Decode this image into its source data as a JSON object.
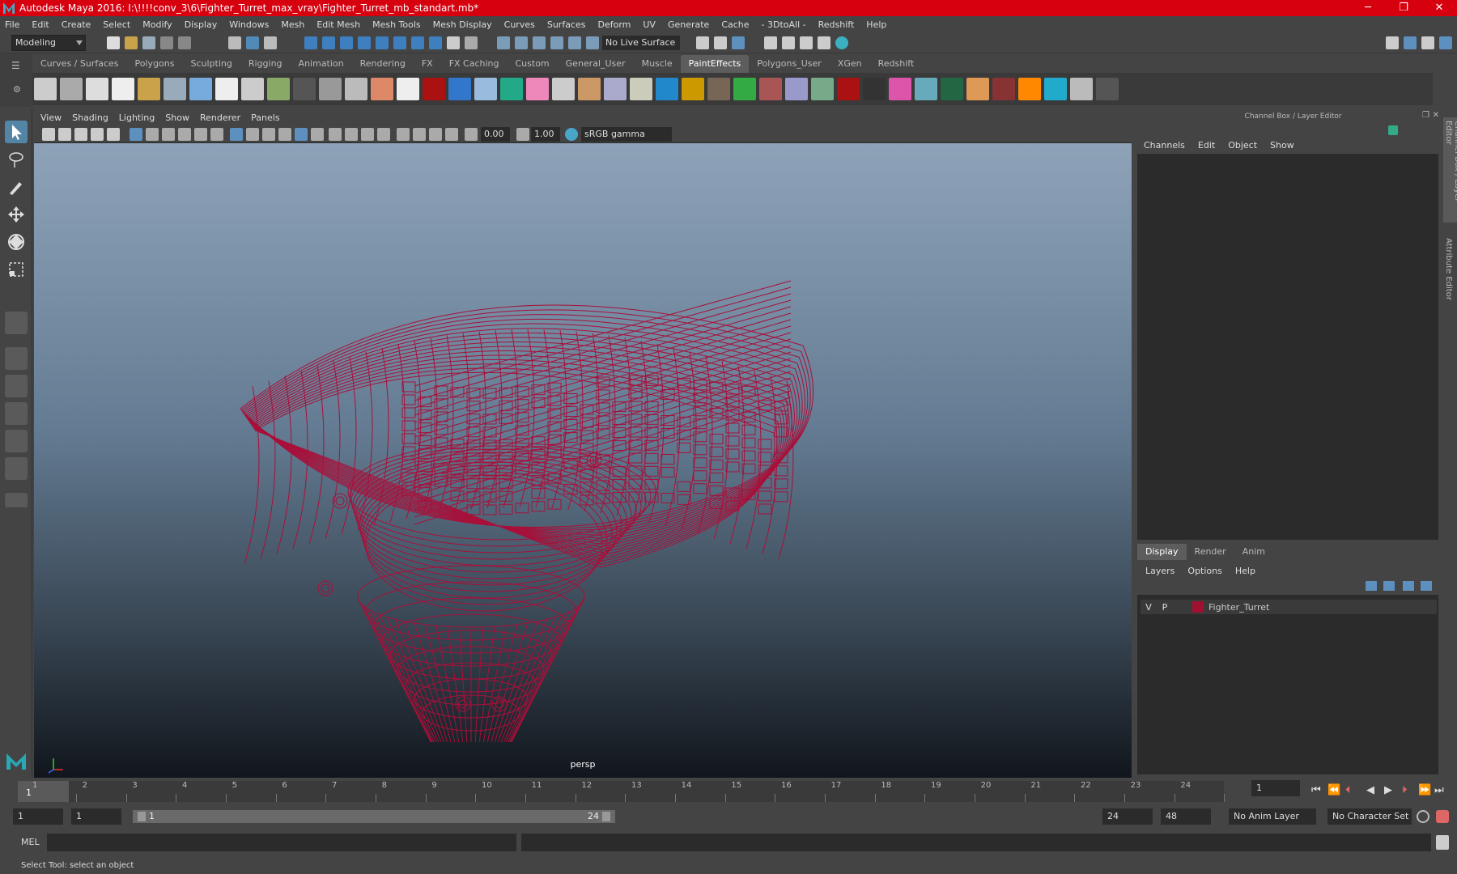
{
  "window": {
    "title": "Autodesk Maya 2016: I:\\!!!!conv_3\\6\\Fighter_Turret_max_vray\\Fighter_Turret_mb_standart.mb*",
    "minimize": "─",
    "maximize": "❐",
    "close": "✕"
  },
  "menubar": [
    "File",
    "Edit",
    "Create",
    "Select",
    "Modify",
    "Display",
    "Windows",
    "Mesh",
    "Edit Mesh",
    "Mesh Tools",
    "Mesh Display",
    "Curves",
    "Surfaces",
    "Deform",
    "UV",
    "Generate",
    "Cache",
    "- 3DtoAll -",
    "Redshift",
    "Help"
  ],
  "toolbar": {
    "mode": "Modeling",
    "live_surface": "No Live Surface"
  },
  "shelf_tabs": [
    "Curves / Surfaces",
    "Polygons",
    "Sculpting",
    "Rigging",
    "Animation",
    "Rendering",
    "FX",
    "FX Caching",
    "Custom",
    "General_User",
    "Muscle",
    "PaintEffects",
    "Polygons_User",
    "XGen",
    "Redshift"
  ],
  "shelf_active": "PaintEffects",
  "viewport": {
    "menu": [
      "View",
      "Shading",
      "Lighting",
      "Show",
      "Renderer",
      "Panels"
    ],
    "exposure": "0.00",
    "gamma": "1.00",
    "color_space": "sRGB gamma",
    "camera": "persp",
    "wire_color": "#a8103a"
  },
  "right_panel": {
    "title": "Channel Box / Layer Editor",
    "menu": [
      "Channels",
      "Edit",
      "Object",
      "Show"
    ],
    "tabs": [
      "Display",
      "Render",
      "Anim"
    ],
    "active_tab": "Display",
    "layer_menu": [
      "Layers",
      "Options",
      "Help"
    ],
    "layer": {
      "v": "V",
      "p": "P",
      "name": "Fighter_Turret",
      "color": "#a01030"
    },
    "side_tabs": [
      "Channel Box / Layer Editor",
      "Attribute Editor"
    ]
  },
  "timeline": {
    "ticks": [
      "1",
      "2",
      "3",
      "4",
      "5",
      "6",
      "7",
      "8",
      "9",
      "10",
      "11",
      "12",
      "13",
      "14",
      "15",
      "16",
      "17",
      "18",
      "19",
      "20",
      "21",
      "22",
      "23",
      "24"
    ],
    "current": "1",
    "frame_field": "1"
  },
  "range": {
    "start": "1",
    "playback_start": "1",
    "bar_start": "1",
    "bar_end": "24",
    "playback_end": "24",
    "end": "48",
    "anim_layer": "No Anim Layer",
    "char_set": "No Character Set"
  },
  "cmdline": {
    "lang": "MEL"
  },
  "status": "Select Tool: select an object"
}
